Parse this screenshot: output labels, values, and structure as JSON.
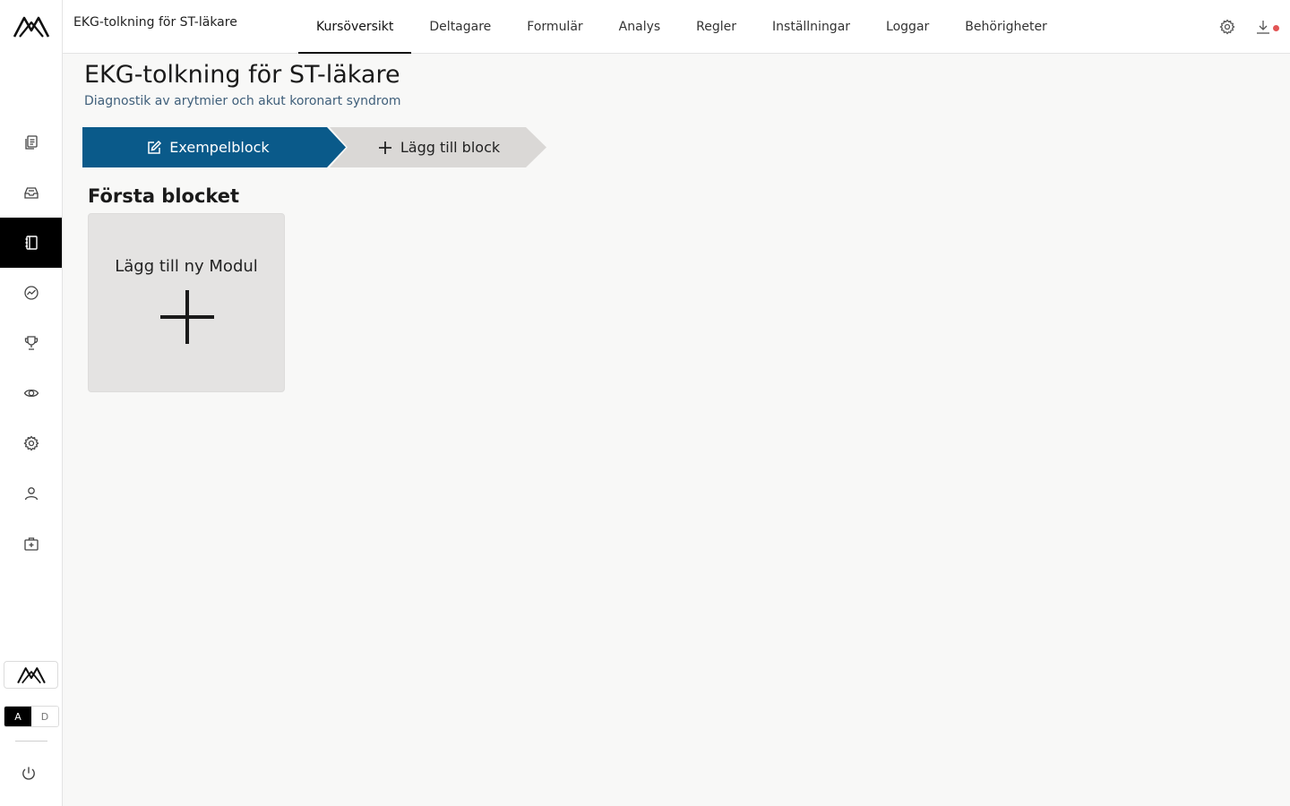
{
  "header": {
    "app_title": "EKG-tolkning för ST-läkare",
    "tabs": [
      {
        "label": "Kursöversikt",
        "active": true
      },
      {
        "label": "Deltagare"
      },
      {
        "label": "Formulär"
      },
      {
        "label": "Analys"
      },
      {
        "label": "Regler"
      },
      {
        "label": "Inställningar"
      },
      {
        "label": "Loggar"
      },
      {
        "label": "Behörigheter"
      }
    ],
    "icons": [
      "gear-icon",
      "download-icon"
    ],
    "notification_color": "#e25555"
  },
  "sidebar": {
    "items": [
      {
        "icon": "documents-icon"
      },
      {
        "icon": "inbox-icon"
      },
      {
        "icon": "notebook-icon",
        "active": true
      },
      {
        "icon": "analytics-icon"
      },
      {
        "icon": "trophy-icon"
      },
      {
        "icon": "eye-icon"
      },
      {
        "icon": "gear-icon"
      },
      {
        "icon": "user-icon"
      },
      {
        "icon": "medical-kit-icon"
      }
    ],
    "lang": {
      "a": "A",
      "d": "D",
      "selected": "A"
    }
  },
  "main": {
    "title": "EKG-tolkning för ST-läkare",
    "subtitle": "Diagnostik av arytmier och akut koronart syndrom",
    "block_tabs": {
      "active_label": "Exempelblock",
      "add_label": "Lägg till block"
    },
    "section_title": "Första blocket",
    "add_module_label": "Lägg till ny Modul"
  },
  "colors": {
    "accent": "#0a5a8a",
    "inactive_tab": "#dad8d6",
    "card": "#e4e3e2"
  }
}
